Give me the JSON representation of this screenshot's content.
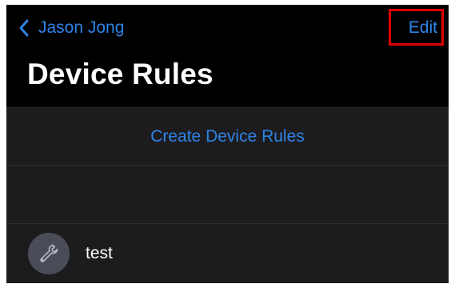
{
  "nav": {
    "back_label": "Jason Jong",
    "edit_label": "Edit"
  },
  "page": {
    "title": "Device Rules"
  },
  "actions": {
    "create_label": "Create Device Rules"
  },
  "rules": [
    {
      "name": "test",
      "icon": "wrench-icon"
    }
  ],
  "colors": {
    "accent": "#2f84e8",
    "background": "#000000",
    "list_background": "#1c1c1e",
    "avatar_background": "#4a4d58",
    "highlight": "#e00000"
  }
}
